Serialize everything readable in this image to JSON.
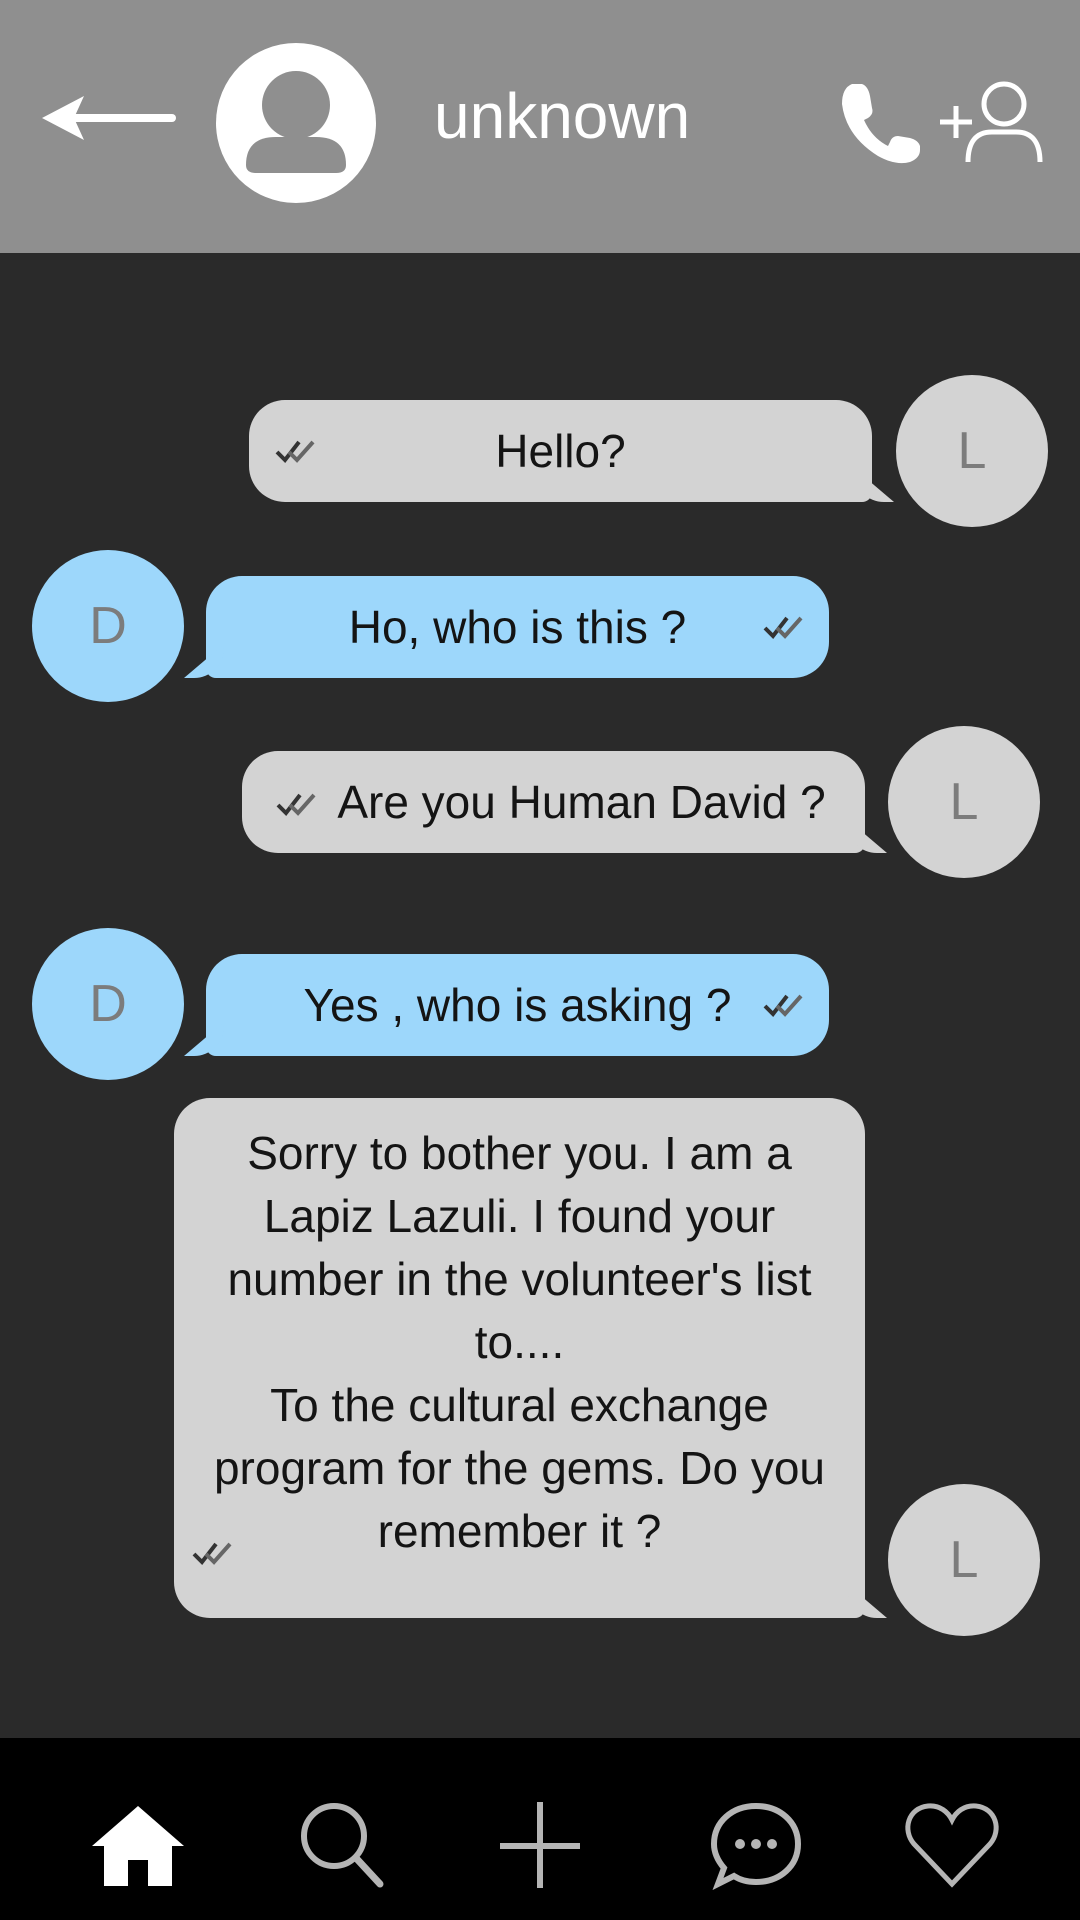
{
  "header": {
    "contact_name": "unknown",
    "icons": {
      "back": "back-arrow-icon",
      "avatar": "user-icon",
      "call": "phone-icon",
      "add_contact": "add-user-icon"
    }
  },
  "messages": [
    {
      "sender": "L",
      "direction": "outgoing",
      "text": "Hello?",
      "status": "read"
    },
    {
      "sender": "D",
      "direction": "incoming",
      "text": "Ho, who is this ?",
      "status": "read"
    },
    {
      "sender": "L",
      "direction": "outgoing",
      "text": "Are you Human David ?",
      "status": "read"
    },
    {
      "sender": "D",
      "direction": "incoming",
      "text": "Yes , who is asking ?",
      "status": "read"
    },
    {
      "sender": "L",
      "direction": "outgoing",
      "text": "Sorry to bother you. I am a Lapiz Lazuli. I found your number in the volunteer's list to....\nTo the cultural exchange program for the gems. Do you remember it ?",
      "status": "read"
    }
  ],
  "bottom_nav": [
    {
      "icon": "home-icon",
      "active": true
    },
    {
      "icon": "search-icon",
      "active": false
    },
    {
      "icon": "plus-icon",
      "active": false
    },
    {
      "icon": "chat-icon",
      "active": false
    },
    {
      "icon": "heart-icon",
      "active": false
    }
  ],
  "colors": {
    "header_bg": "#8f8f8f",
    "chat_bg": "#2a2a2a",
    "outgoing_bubble": "#d3d3d3",
    "incoming_bubble": "#9dd7fb",
    "nav_bg": "#000000"
  }
}
